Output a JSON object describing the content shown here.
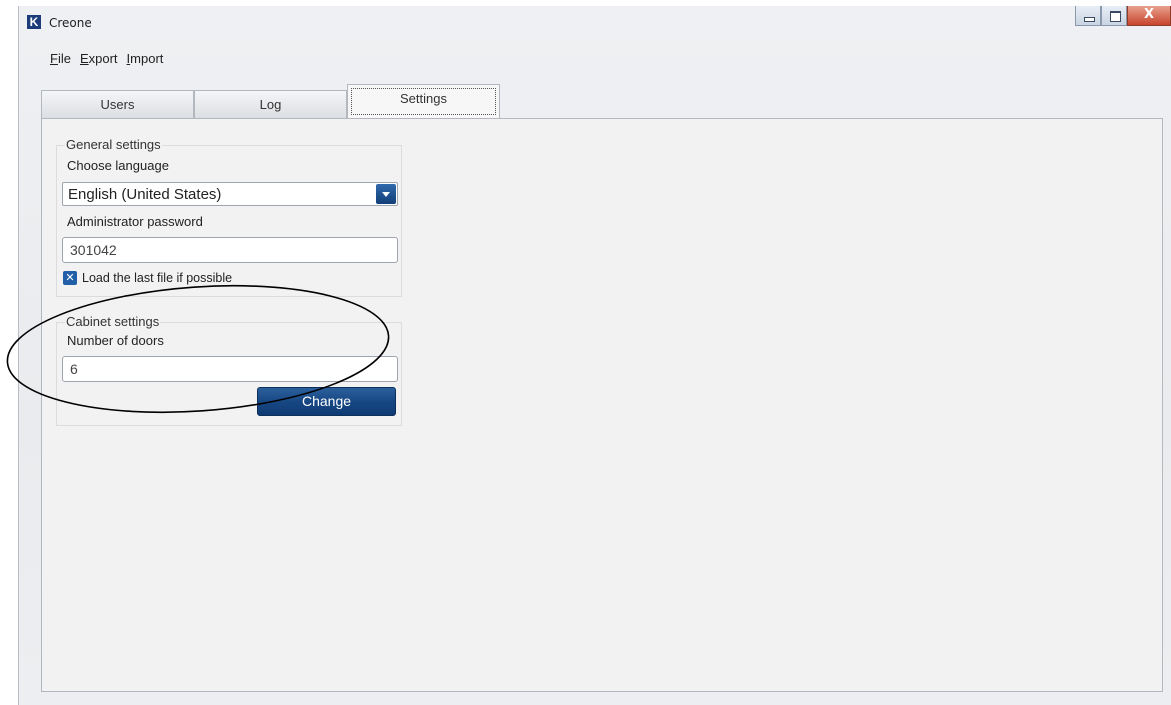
{
  "window": {
    "title": "Creone",
    "logo_letter": "K",
    "controls": [
      "minimize-icon",
      "maximize-icon",
      "close-icon"
    ],
    "close_glyph": "X"
  },
  "menu": {
    "file": {
      "mnemonic": "F",
      "rest": "ile"
    },
    "export": {
      "mnemonic": "E",
      "rest": "xport"
    },
    "import": {
      "mnemonic": "I",
      "rest": "mport"
    }
  },
  "tabs": [
    {
      "label": "Users"
    },
    {
      "label": "Log"
    },
    {
      "label": "Settings",
      "active": true
    }
  ],
  "general_settings": {
    "legend": "General settings",
    "language_label": "Choose language",
    "language_value": "English (United States)",
    "password_label": "Administrator password",
    "password_value": "301042",
    "load_last_checked": true,
    "load_last_label": "Load the last file if possible"
  },
  "cabinet_settings": {
    "legend": "Cabinet settings",
    "doors_label": "Number of doors",
    "doors_value": "6",
    "change_label": "Change"
  },
  "colors": {
    "accent": "#164682",
    "checkbox": "#2160a8",
    "annotation": "#000000"
  }
}
